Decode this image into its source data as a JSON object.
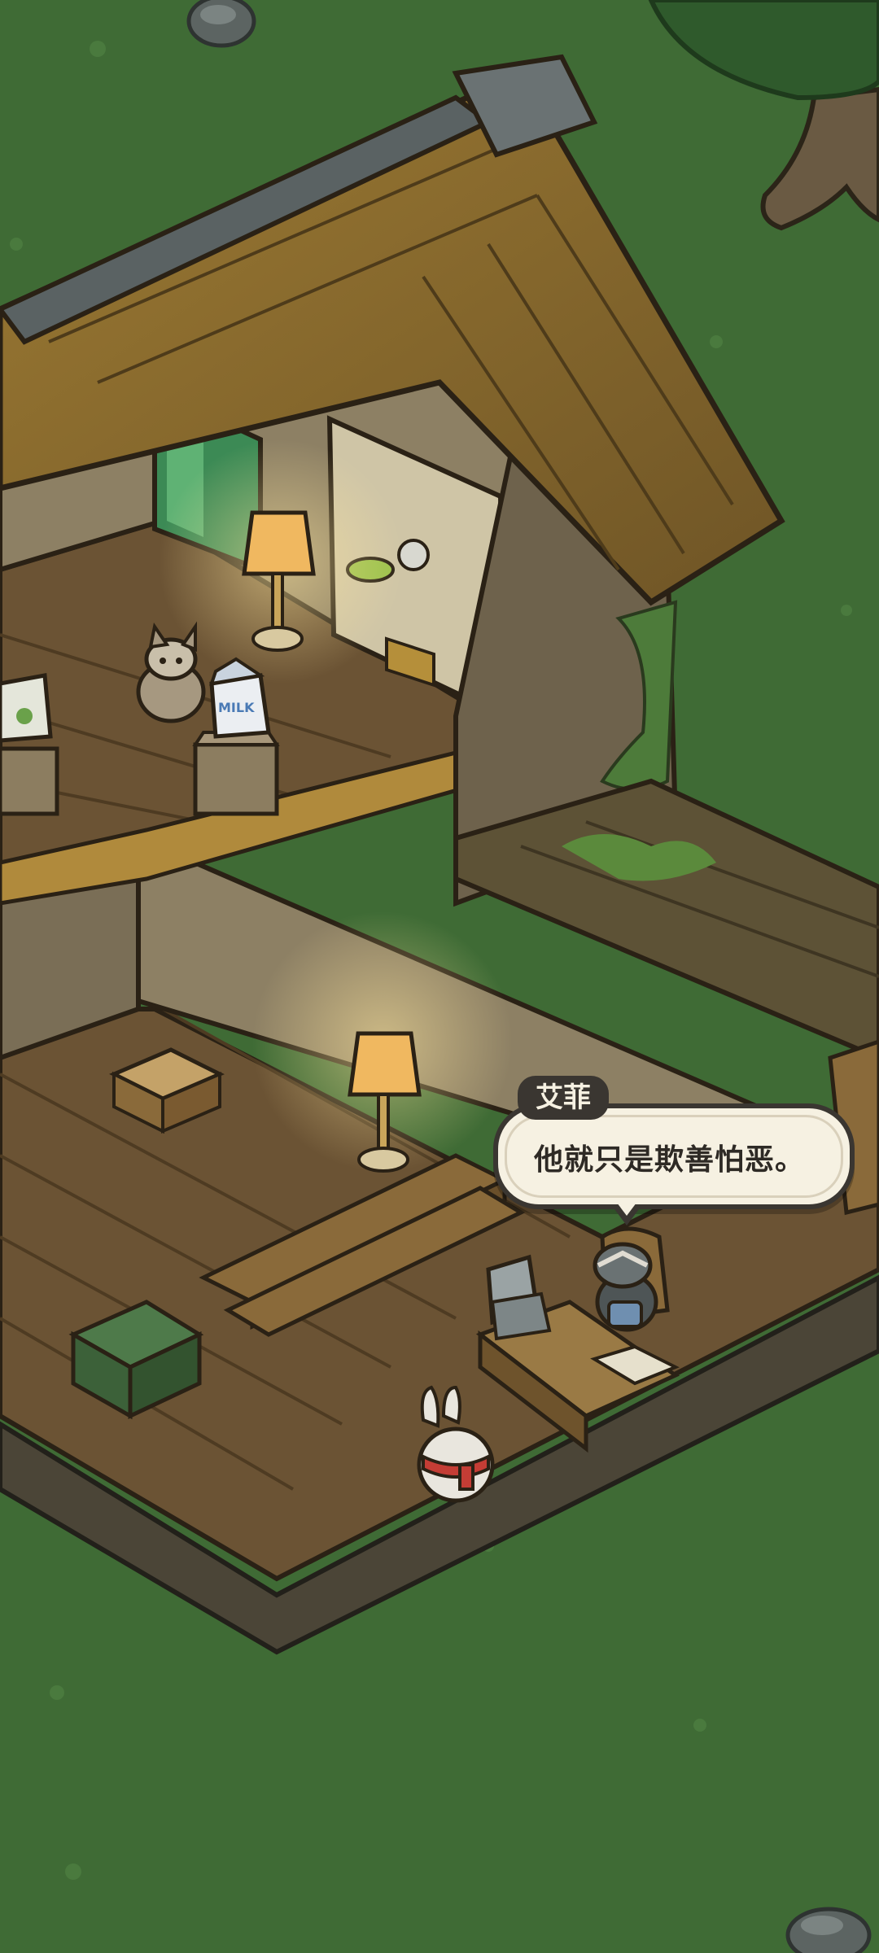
{
  "dialogue": {
    "speaker": "艾菲",
    "text": "他就只是欺善怕恶。"
  },
  "props": {
    "milk_carton_label": "MILK"
  },
  "colors": {
    "grass": "#3f6b35",
    "roof": "#8a6a2a",
    "wood_floor": "#6b5334",
    "wall": "#8d8064",
    "bubble_bg": "#f6f1e2",
    "bubble_border": "#3a3631"
  }
}
